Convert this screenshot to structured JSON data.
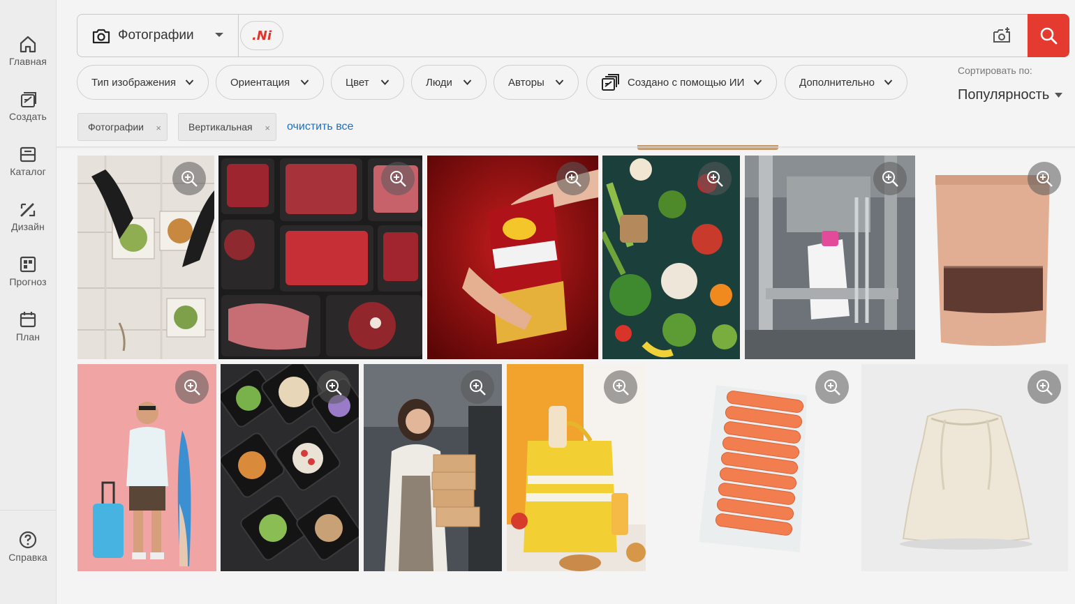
{
  "sidebar": {
    "items": [
      {
        "label": "Главная",
        "icon": "home-icon"
      },
      {
        "label": "Создать",
        "icon": "create-icon"
      },
      {
        "label": "Каталог",
        "icon": "catalog-icon"
      },
      {
        "label": "Дизайн",
        "icon": "design-icon"
      },
      {
        "label": "Прогноз",
        "icon": "forecast-icon"
      },
      {
        "label": "План",
        "icon": "plan-icon"
      }
    ],
    "help": {
      "label": "Справка",
      "icon": "help-icon"
    }
  },
  "search": {
    "type_label": "Фотографии",
    "ai_toggle_label": ".Ni",
    "query": "",
    "placeholder": "",
    "accent_color": "#e53a2f"
  },
  "filters": [
    {
      "label": "Тип изображения"
    },
    {
      "label": "Ориентация"
    },
    {
      "label": "Цвет"
    },
    {
      "label": "Люди"
    },
    {
      "label": "Авторы"
    },
    {
      "label": "Создано с помощью ИИ",
      "icon": "ai-generated-icon"
    },
    {
      "label": "Дополнительно"
    }
  ],
  "sort": {
    "label": "Сортировать по:",
    "value": "Популярность"
  },
  "active_filters": [
    {
      "label": "Фотографии",
      "remove": "×"
    },
    {
      "label": "Вертикальная",
      "remove": "×"
    }
  ],
  "clear_all_label": "очистить все",
  "results": [
    {
      "subject": "food-containers-gloves"
    },
    {
      "subject": "raw-meat-trays"
    },
    {
      "subject": "lays-strong-chips"
    },
    {
      "subject": "vegetables-shopping-bags"
    },
    {
      "subject": "packaging-machine"
    },
    {
      "subject": "kraft-pouch"
    },
    {
      "subject": "man-with-surfboard"
    },
    {
      "subject": "meal-prep-containers"
    },
    {
      "subject": "woman-with-boxes"
    },
    {
      "subject": "grocery-bag"
    },
    {
      "subject": "packed-sausages"
    },
    {
      "subject": "canvas-drawstring-bag"
    }
  ]
}
